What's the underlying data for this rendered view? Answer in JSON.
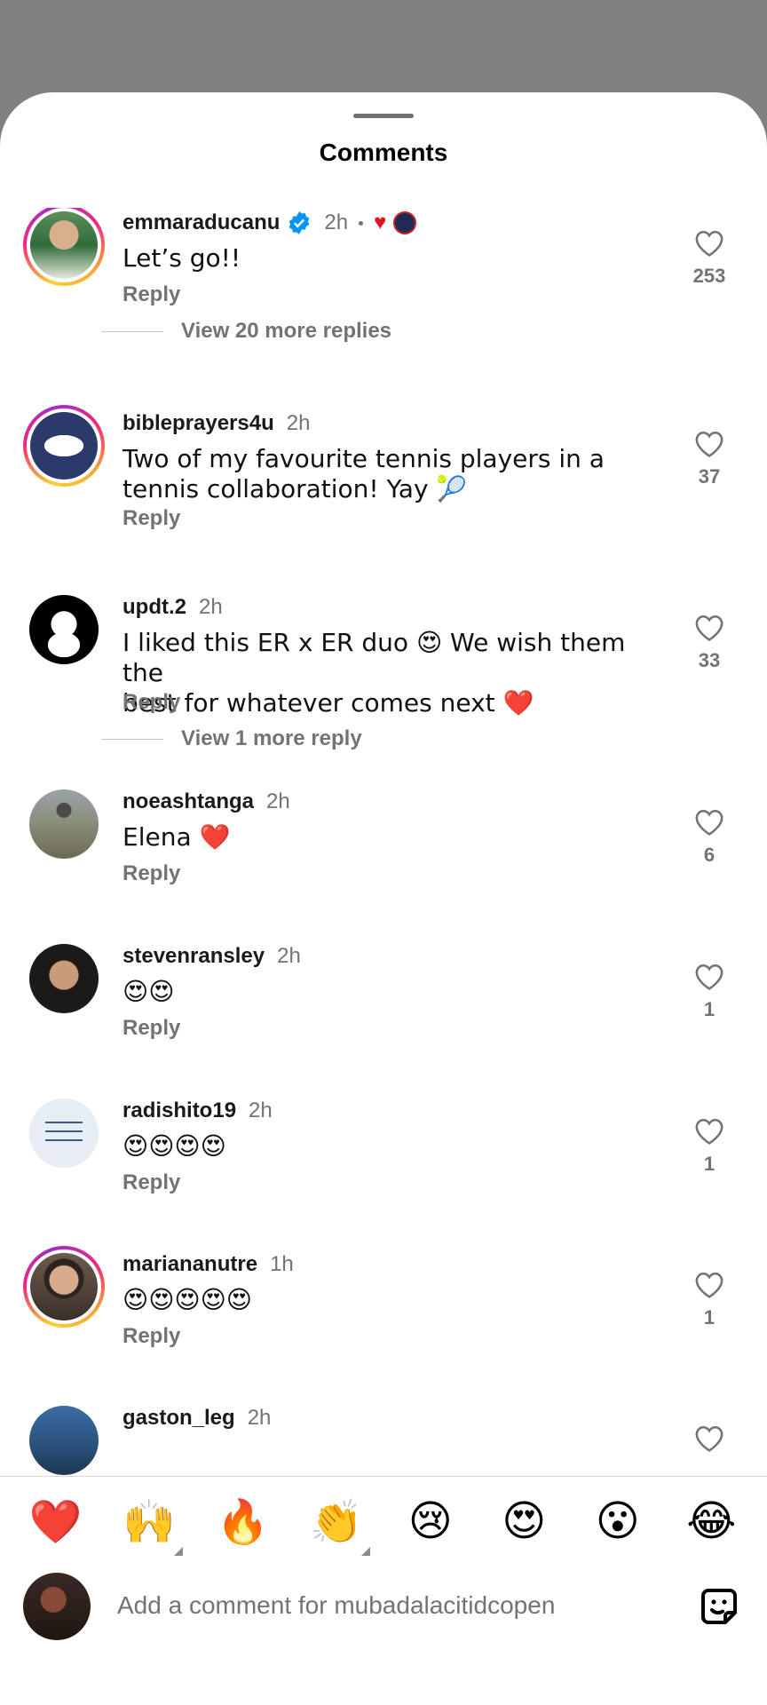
{
  "sheet": {
    "title": "Comments"
  },
  "comments": [
    {
      "username": "emmaraducanu",
      "time": "2h",
      "text": "Let’s go!!",
      "reply_label": "Reply",
      "likes": "253",
      "verified": true,
      "view_more": "View 20 more replies"
    },
    {
      "username": "bibleprayers4u",
      "time": "2h",
      "text_line1": "Two of my favourite tennis players in a",
      "text_line2": "tennis collaboration! Yay 🎾",
      "reply_label": "Reply",
      "likes": "37"
    },
    {
      "username": "updt.2",
      "time": "2h",
      "text_line1": "I liked this ER x ER duo 😍 We wish them the",
      "text_line2": "best for whatever comes next ❤️",
      "reply_label": "Reply",
      "likes": "33",
      "view_more": "View 1 more reply"
    },
    {
      "username": "noeashtanga",
      "time": "2h",
      "text": "Elena ❤️",
      "reply_label": "Reply",
      "likes": "6"
    },
    {
      "username": "stevenransley",
      "time": "2h",
      "text": "😍😍",
      "reply_label": "Reply",
      "likes": "1"
    },
    {
      "username": "radishito19",
      "time": "2h",
      "text": "😍😍😍😍",
      "reply_label": "Reply",
      "likes": "1"
    },
    {
      "username": "mariananutre",
      "time": "1h",
      "text": "😍😍😍😍😍",
      "reply_label": "Reply",
      "likes": "1"
    },
    {
      "username": "gaston_leg",
      "time": "2h"
    }
  ],
  "quick_reactions": [
    "❤️",
    "🙌",
    "🔥",
    "👏",
    "😢",
    "😍",
    "😮",
    "😂"
  ],
  "composer": {
    "placeholder": "Add a comment for mubadalacitidcopen"
  },
  "colors": {
    "accent_verified": "#0095f6",
    "heart_red": "#e0141e",
    "secondary_text": "#737373"
  },
  "icons": [
    "verified-badge-icon",
    "heart-outline-icon",
    "sticker-icon"
  ]
}
